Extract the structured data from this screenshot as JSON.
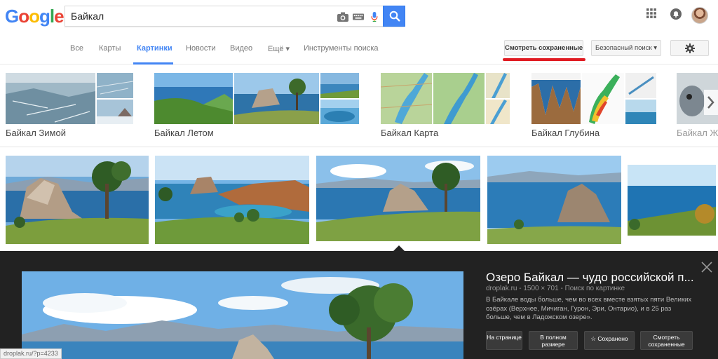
{
  "header": {
    "logo_letters": [
      "G",
      "o",
      "o",
      "g",
      "l",
      "e"
    ],
    "logo_colors": [
      "#4285f4",
      "#ea4335",
      "#fbbc05",
      "#4285f4",
      "#34a853",
      "#ea4335"
    ],
    "search_value": "Байкал",
    "icons": [
      "camera-icon",
      "keyboard-icon",
      "microphone-icon",
      "search-icon",
      "apps-icon",
      "notifications-icon",
      "avatar"
    ]
  },
  "tabs": [
    {
      "label": "Все"
    },
    {
      "label": "Карты"
    },
    {
      "label": "Картинки",
      "active": true
    },
    {
      "label": "Новости"
    },
    {
      "label": "Видео"
    },
    {
      "label": "Ещё ▾"
    },
    {
      "label": "Инструменты поиска"
    }
  ],
  "toolbar": {
    "saved_label": "Смотреть сохраненные",
    "safe_search_label": "Безопасный поиск ▾"
  },
  "related": [
    {
      "label": "Байкал Зимой"
    },
    {
      "label": "Байкал Летом"
    },
    {
      "label": "Байкал Карта"
    },
    {
      "label": "Байкал Глубина"
    },
    {
      "label": "Байкал Ж"
    }
  ],
  "preview": {
    "title": "Озеро Байкал — чудо российской п...",
    "meta": "droplak.ru - 1500 × 701 - Поиск по картинке",
    "description": "В Байкале воды больше, чем во всех вместе взятых пяти Великих озёрах (Верхнее, Мичиган, Гурон, Эри, Онтарио), и в 25 раз больше, чем в Ладожском озере».",
    "buttons": {
      "visit": "На странице",
      "full": "В полном размере",
      "saved": "☆ Сохранено",
      "view_saved": "Смотреть сохраненные"
    }
  },
  "status_url": "droplak.ru/?p=4233",
  "colors": {
    "accent": "#4285f4",
    "highlight": "#e01b22",
    "panel_bg": "#222222"
  }
}
